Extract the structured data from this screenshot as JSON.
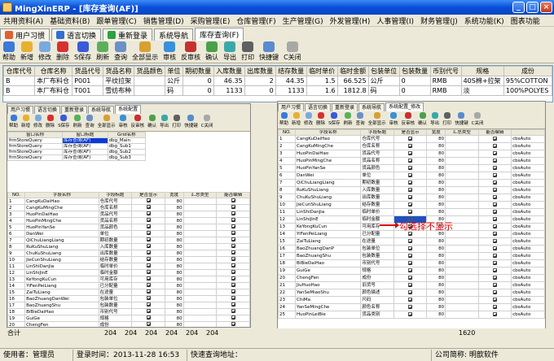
{
  "app": {
    "title": "MingXinERP - [库存查询(AF)]",
    "controls": [
      "_",
      "□",
      "×"
    ]
  },
  "menu": [
    "共用资料(A)",
    "基础资料(B)",
    "跟单管理(C)",
    "销售管理(D)",
    "采购管理(E)",
    "仓库管理(F)",
    "生产管理(G)",
    "外发管理(H)",
    "人事管理(I)",
    "财务管理(J)",
    "系统功能(K)",
    "图表功能"
  ],
  "tabs": [
    {
      "label": "用户习惯",
      "color": "#e06030"
    },
    {
      "label": "语言切换",
      "color": "#3070d0"
    },
    {
      "label": "重新登录",
      "color": "#30a040"
    },
    {
      "label": "系统导航",
      "color": ""
    },
    {
      "label": "库存查询(F)",
      "color": ""
    }
  ],
  "toolbar": [
    {
      "label": "帮助",
      "color": "#3a7ad8"
    },
    {
      "label": "新增",
      "color": "#e8b030"
    },
    {
      "label": "修改",
      "color": "#7aa8e0"
    },
    {
      "label": "删除",
      "color": "#d83030"
    },
    {
      "label": "S保存",
      "color": "#3a5ad8"
    },
    {
      "label": "刷新",
      "color": "#5ab05a"
    },
    {
      "label": "查询",
      "color": "#6a90c8"
    },
    {
      "label": "全部显示",
      "color": "#d8a030"
    },
    {
      "label": "审核",
      "color": "#3a90d8"
    },
    {
      "label": "反审核",
      "color": "#c83030"
    },
    {
      "label": "确认",
      "color": "#4aa04a"
    },
    {
      "label": "导出",
      "color": "#3aa8a8"
    },
    {
      "label": "打印",
      "color": "#606060"
    },
    {
      "label": "快捷键",
      "color": "#5a8ad0"
    },
    {
      "label": "C关闭",
      "color": "#a8a8a8"
    }
  ],
  "grid": {
    "headers": [
      "仓库代号",
      "仓库名称",
      "货品代号",
      "货品名称",
      "货品颜色",
      "单位",
      "期初数量",
      "入库数量",
      "出库数量",
      "结存数量",
      "临时单价",
      "临时金额",
      "包装单位",
      "包装数量",
      "币别代号",
      "规格",
      "成份"
    ],
    "rows": [
      [
        "B",
        "本厂布料仓",
        "P001",
        "平纹拉架",
        "",
        "公斤",
        "0",
        "46.35",
        "2",
        "44.35",
        "1.5",
        "66.525",
        "公斤",
        "0",
        "RMB",
        "40S棉+拉架",
        "95%COTTON"
      ],
      [
        "B",
        "本厂布料仓",
        "T001",
        "雪纺布种",
        "",
        "码",
        "0",
        "1133",
        "0",
        "1133",
        "1.6",
        "1812.8",
        "码",
        "0",
        "RMB",
        "淡",
        "100%POLYES"
      ]
    ]
  },
  "left_win": {
    "tabs": [
      "用户习惯",
      "语言切换",
      "重新登录",
      "系统导航",
      "系统配置"
    ],
    "tools": [
      "帮助",
      "新增",
      "修改",
      "删除",
      "S保存",
      "刷新",
      "查询",
      "全部显示",
      "审核",
      "反审核",
      "确认",
      "导出",
      "打印",
      "快捷键",
      "C关闭"
    ],
    "top_headers": [
      "窗口名称",
      "窗口标题",
      "Grid名称"
    ],
    "top_rows": [
      [
        "frmStoreQuery",
        "库存查询(AF)",
        "dbg_Main"
      ],
      [
        "frmStoreQuery",
        "库存查询(AF)",
        "dbg_Sub1"
      ],
      [
        "frmStoreQuery",
        "库存查询(AF)",
        "dbg_Sub2"
      ],
      [
        "frmStoreQuery",
        "库存查询(AF)",
        "dbg_Sub3"
      ]
    ],
    "headers": [
      "NO.",
      "字段名称",
      "字段标题",
      "是否显示",
      "宽度",
      "汇总类型",
      "能否编辑"
    ],
    "rows": [
      [
        "1",
        "CangKuDaiHao",
        "仓库代号",
        "1",
        "80",
        "",
        ""
      ],
      [
        "2",
        "CangKuMingChe",
        "仓库名称",
        "1",
        "80",
        "",
        ""
      ],
      [
        "3",
        "HuoPinDaiHao",
        "货品代号",
        "1",
        "80",
        "",
        ""
      ],
      [
        "4",
        "HuoPinMingChe",
        "货品名称",
        "1",
        "80",
        "",
        ""
      ],
      [
        "5",
        "HuoPinYanSe",
        "货品颜色",
        "1",
        "80",
        "",
        ""
      ],
      [
        "6",
        "DanWei",
        "单位",
        "1",
        "80",
        "",
        ""
      ],
      [
        "7",
        "QiChuLiangLiang",
        "期初数量",
        "1",
        "80",
        "",
        ""
      ],
      [
        "8",
        "RuKuShuLiang",
        "入库数量",
        "1",
        "80",
        "",
        ""
      ],
      [
        "9",
        "ChuKuShuLiang",
        "出库数量",
        "1",
        "80",
        "",
        ""
      ],
      [
        "10",
        "JieCunShuLiang",
        "结存数量",
        "1",
        "80",
        "",
        ""
      ],
      [
        "11",
        "LinShiDanJia",
        "临时单价",
        "1",
        "80",
        "",
        ""
      ],
      [
        "12",
        "LinShiJinE",
        "临时金额",
        "1",
        "80",
        "",
        ""
      ],
      [
        "13",
        "KeYongKuCun",
        "可用库存",
        "1",
        "80",
        "",
        ""
      ],
      [
        "14",
        "YiFenPeiLiang",
        "已分配量",
        "1",
        "80",
        "",
        ""
      ],
      [
        "15",
        "ZaiTuLiang",
        "在途量",
        "1",
        "80",
        "",
        ""
      ],
      [
        "16",
        "BaoZhuangDanWei",
        "包装单位",
        "1",
        "80",
        "",
        ""
      ],
      [
        "17",
        "BaoZhuangShu",
        "包装数量",
        "1",
        "80",
        "",
        ""
      ],
      [
        "18",
        "BiBieDaiHao",
        "币别代号",
        "1",
        "80",
        "",
        ""
      ],
      [
        "19",
        "GuiGe",
        "规格",
        "1",
        "80",
        "",
        ""
      ],
      [
        "20",
        "ChengFen",
        "成份",
        "1",
        "80",
        "",
        ""
      ]
    ]
  },
  "right_win": {
    "tabs": [
      "用户习惯",
      "语言切换",
      "重新登录",
      "系统导航",
      "系统配置_修改"
    ],
    "tools": [
      "帮助",
      "新增",
      "修改",
      "删除",
      "S保存",
      "刷新",
      "查询",
      "全部显示",
      "审核",
      "反审核",
      "确认",
      "导出",
      "打印",
      "快捷键",
      "C关闭"
    ],
    "headers": [
      "NO.",
      "字段名称",
      "字段标题",
      "是否显示",
      "宽度",
      "汇总类型",
      "能否编辑",
      ""
    ],
    "rows": [
      [
        "1",
        "CangKuDaiHao",
        "仓库代号",
        "1",
        "80",
        "",
        "",
        "cbsAuto"
      ],
      [
        "2",
        "CangKuMingChe",
        "仓库名称",
        "1",
        "80",
        "",
        "",
        "cbsAuto"
      ],
      [
        "3",
        "HuoPinDaiHao",
        "货品代号",
        "1",
        "80",
        "",
        "",
        "cbsAuto"
      ],
      [
        "4",
        "HuoPinMingChe",
        "货品名称",
        "1",
        "80",
        "",
        "",
        "cbsAuto"
      ],
      [
        "5",
        "HuoPinYanSe",
        "货品颜色",
        "1",
        "80",
        "",
        "",
        "cbsAuto"
      ],
      [
        "6",
        "DanWei",
        "单位",
        "1",
        "80",
        "",
        "",
        "cbsAuto"
      ],
      [
        "7",
        "QiChuLiangLiang",
        "期初数量",
        "1",
        "80",
        "",
        "",
        "cbsAuto"
      ],
      [
        "8",
        "RuKuShuLiang",
        "入库数量",
        "1",
        "80",
        "",
        "",
        "cbsAuto"
      ],
      [
        "9",
        "ChuKuShuLiang",
        "出库数量",
        "1",
        "80",
        "",
        "",
        "cbsAuto"
      ],
      [
        "10",
        "JieCunShuLiang",
        "结存数量",
        "1",
        "80",
        "",
        "",
        "cbsAuto"
      ],
      [
        "11",
        "LinShiDanJia",
        "临时单价",
        "1",
        "80",
        "",
        "",
        "cbsAuto"
      ],
      [
        "12",
        "LinShiJinE",
        "临时金额",
        "0",
        "80",
        "",
        "",
        "cbsAuto"
      ],
      [
        "13",
        "KeYongKuCun",
        "可用库存",
        "1",
        "80",
        "",
        "",
        "cbsAuto"
      ],
      [
        "14",
        "YiFenPeiLiang",
        "已分配量",
        "1",
        "80",
        "",
        "",
        "cbsAuto"
      ],
      [
        "15",
        "ZaiTuLiang",
        "在途量",
        "1",
        "80",
        "",
        "",
        "cbsAuto"
      ],
      [
        "16",
        "BaoZhuangDanP",
        "包装单位",
        "1",
        "80",
        "",
        "",
        "cbsAuto"
      ],
      [
        "17",
        "BaoZhuangShu",
        "包装数量",
        "1",
        "80",
        "",
        "",
        "cbsAuto"
      ],
      [
        "18",
        "BiBieDaiHao",
        "币别代号",
        "1",
        "80",
        "",
        "",
        "cbsAuto"
      ],
      [
        "19",
        "GuiGe",
        "规格",
        "1",
        "80",
        "",
        "",
        "cbsAuto"
      ],
      [
        "20",
        "ChengFen",
        "成份",
        "1",
        "80",
        "",
        "",
        "cbsAuto"
      ],
      [
        "21",
        "JiuHuoHao",
        "旧货号",
        "1",
        "80",
        "",
        "",
        "cbsAuto"
      ],
      [
        "22",
        "YanSeMiaoShu",
        "颜色描述",
        "1",
        "80",
        "",
        "",
        "cbsAuto"
      ],
      [
        "23",
        "ChiMa",
        "尺码",
        "1",
        "80",
        "",
        "",
        "cbsAuto"
      ],
      [
        "24",
        "YanSeMingChe",
        "颜色名称",
        "1",
        "80",
        "",
        "",
        "cbsAuto"
      ],
      [
        "25",
        "HuoPinLeiBie",
        "货品类别",
        "1",
        "80",
        "",
        "",
        "cbsAuto"
      ]
    ]
  },
  "annotation": "勾选择不显示",
  "summary": {
    "label": "合计",
    "values": [
      "204",
      "204",
      "204",
      "204",
      "204",
      "204",
      "1620"
    ]
  },
  "status": {
    "user": "使用者：管理员",
    "login": "登录时间：2013-11-28 16:53",
    "quick": "快速查询地址：",
    "company": "公司简称: 明歆软件"
  }
}
